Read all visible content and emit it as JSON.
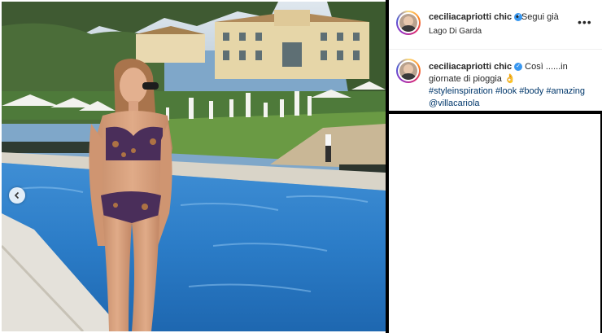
{
  "post": {
    "username": "ceciliacapriotti chic",
    "follow_status": "Segui già",
    "location": "Lago Di Garda",
    "more_label": "•••",
    "caption_user": "ceciliacapriotti chic",
    "caption_text": "Così ......in giornate di pioggia",
    "caption_emoji": "👌",
    "hashtags": [
      "#styleinspiration",
      "#look",
      "#body",
      "#amazing",
      "@villacariola"
    ]
  },
  "nav": {
    "prev_icon": "chevron-left-icon"
  },
  "colors": {
    "verified": "#3897f0",
    "hashtag": "#00376b",
    "text": "#262626"
  }
}
